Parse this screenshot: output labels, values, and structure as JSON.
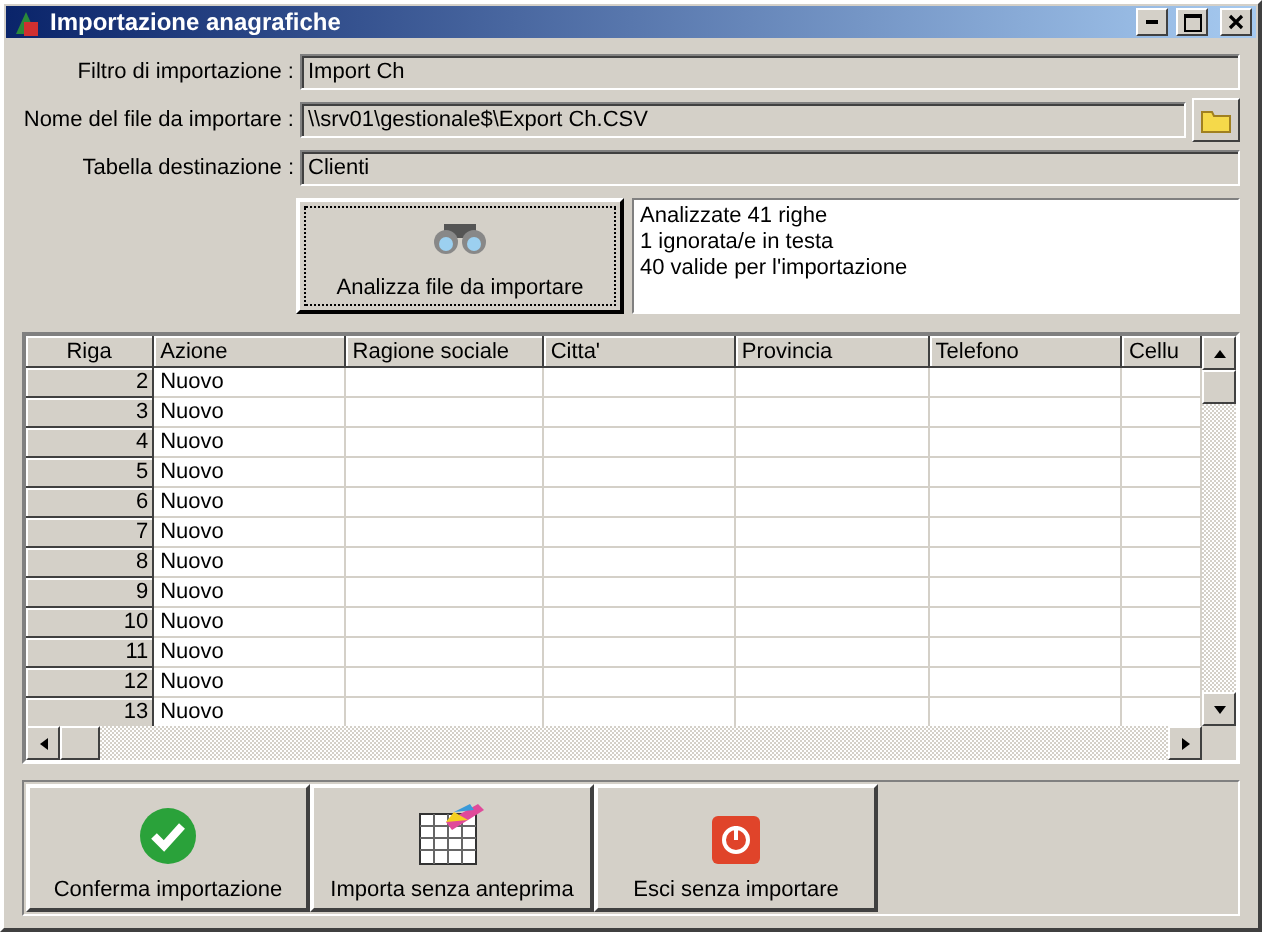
{
  "window": {
    "title": "Importazione anagrafiche"
  },
  "fields": [
    {
      "label": "Filtro di importazione :",
      "value": "Import Ch",
      "browse": false
    },
    {
      "label": "Nome del file da importare :",
      "value": "\\\\srv01\\gestionale$\\Export Ch.CSV",
      "browse": true
    },
    {
      "label": "Tabella destinazione :",
      "value": "Clienti",
      "browse": false
    }
  ],
  "analyze_button": {
    "label": "Analizza file da importare"
  },
  "analysis_log": [
    "Analizzate 41 righe",
    "1 ignorata/e in testa",
    "40 valide per l'importazione"
  ],
  "table": {
    "columns": [
      "Riga",
      "Azione",
      "Ragione sociale",
      "Citta'",
      "Provincia",
      "Telefono",
      "Cellu"
    ],
    "rows": [
      {
        "riga": "2",
        "azione": "Nuovo"
      },
      {
        "riga": "3",
        "azione": "Nuovo"
      },
      {
        "riga": "4",
        "azione": "Nuovo"
      },
      {
        "riga": "5",
        "azione": "Nuovo"
      },
      {
        "riga": "6",
        "azione": "Nuovo"
      },
      {
        "riga": "7",
        "azione": "Nuovo"
      },
      {
        "riga": "8",
        "azione": "Nuovo"
      },
      {
        "riga": "9",
        "azione": "Nuovo"
      },
      {
        "riga": "10",
        "azione": "Nuovo"
      },
      {
        "riga": "11",
        "azione": "Nuovo"
      },
      {
        "riga": "12",
        "azione": "Nuovo"
      },
      {
        "riga": "13",
        "azione": "Nuovo"
      }
    ]
  },
  "actions": [
    {
      "kind": "confirm",
      "label": "Conferma importazione"
    },
    {
      "kind": "import",
      "label": "Importa senza anteprima"
    },
    {
      "kind": "exit",
      "label": "Esci senza importare"
    }
  ]
}
